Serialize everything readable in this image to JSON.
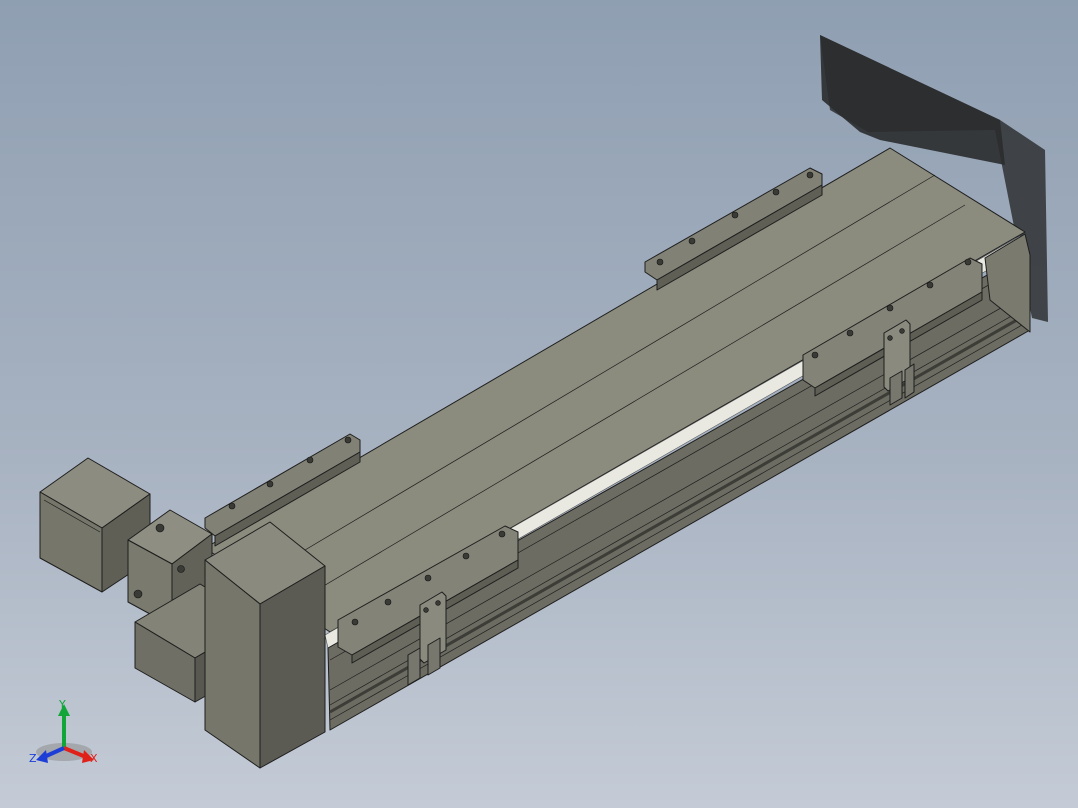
{
  "triad": {
    "x_label": "X",
    "y_label": "Y",
    "z_label": "Z",
    "x_color": "#e0211a",
    "y_color": "#12a53a",
    "z_color": "#1d3ed6"
  },
  "colors": {
    "background_top": "#8f9fb2",
    "background_bottom": "#c4cbd6",
    "body_top": "#8a8a7d",
    "body_side": "#6e6e63",
    "edge": "#1e1e1e",
    "shadow": "#333333"
  }
}
